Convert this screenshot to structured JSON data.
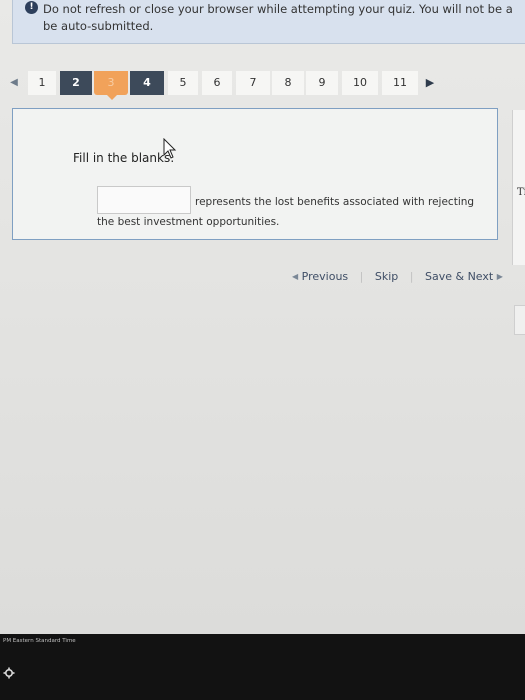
{
  "banner": {
    "line1": "Do not refresh or close your browser while attempting your quiz. You will not be a",
    "line2": "be auto-submitted."
  },
  "pagination": {
    "pages": [
      "1",
      "2",
      "3",
      "4",
      "5",
      "6",
      "7",
      "8",
      "9",
      "10",
      "11"
    ],
    "current": "3"
  },
  "question": {
    "prompt": "Fill in the blanks:",
    "blank_value": "",
    "sentence_part1": "represents the lost benefits associated with rejecting",
    "sentence_part2": "the best investment opportunities."
  },
  "side": {
    "letter": "Ti"
  },
  "nav": {
    "previous": "Previous",
    "skip": "Skip",
    "save_next": "Save & Next"
  },
  "taskbar": {
    "timezone": "PM Eastern Standard Time"
  },
  "colors": {
    "done": "#3d4a5a",
    "current": "#f1a25a",
    "question_border": "#7f9fc2",
    "banner": "#d8e1ee"
  }
}
